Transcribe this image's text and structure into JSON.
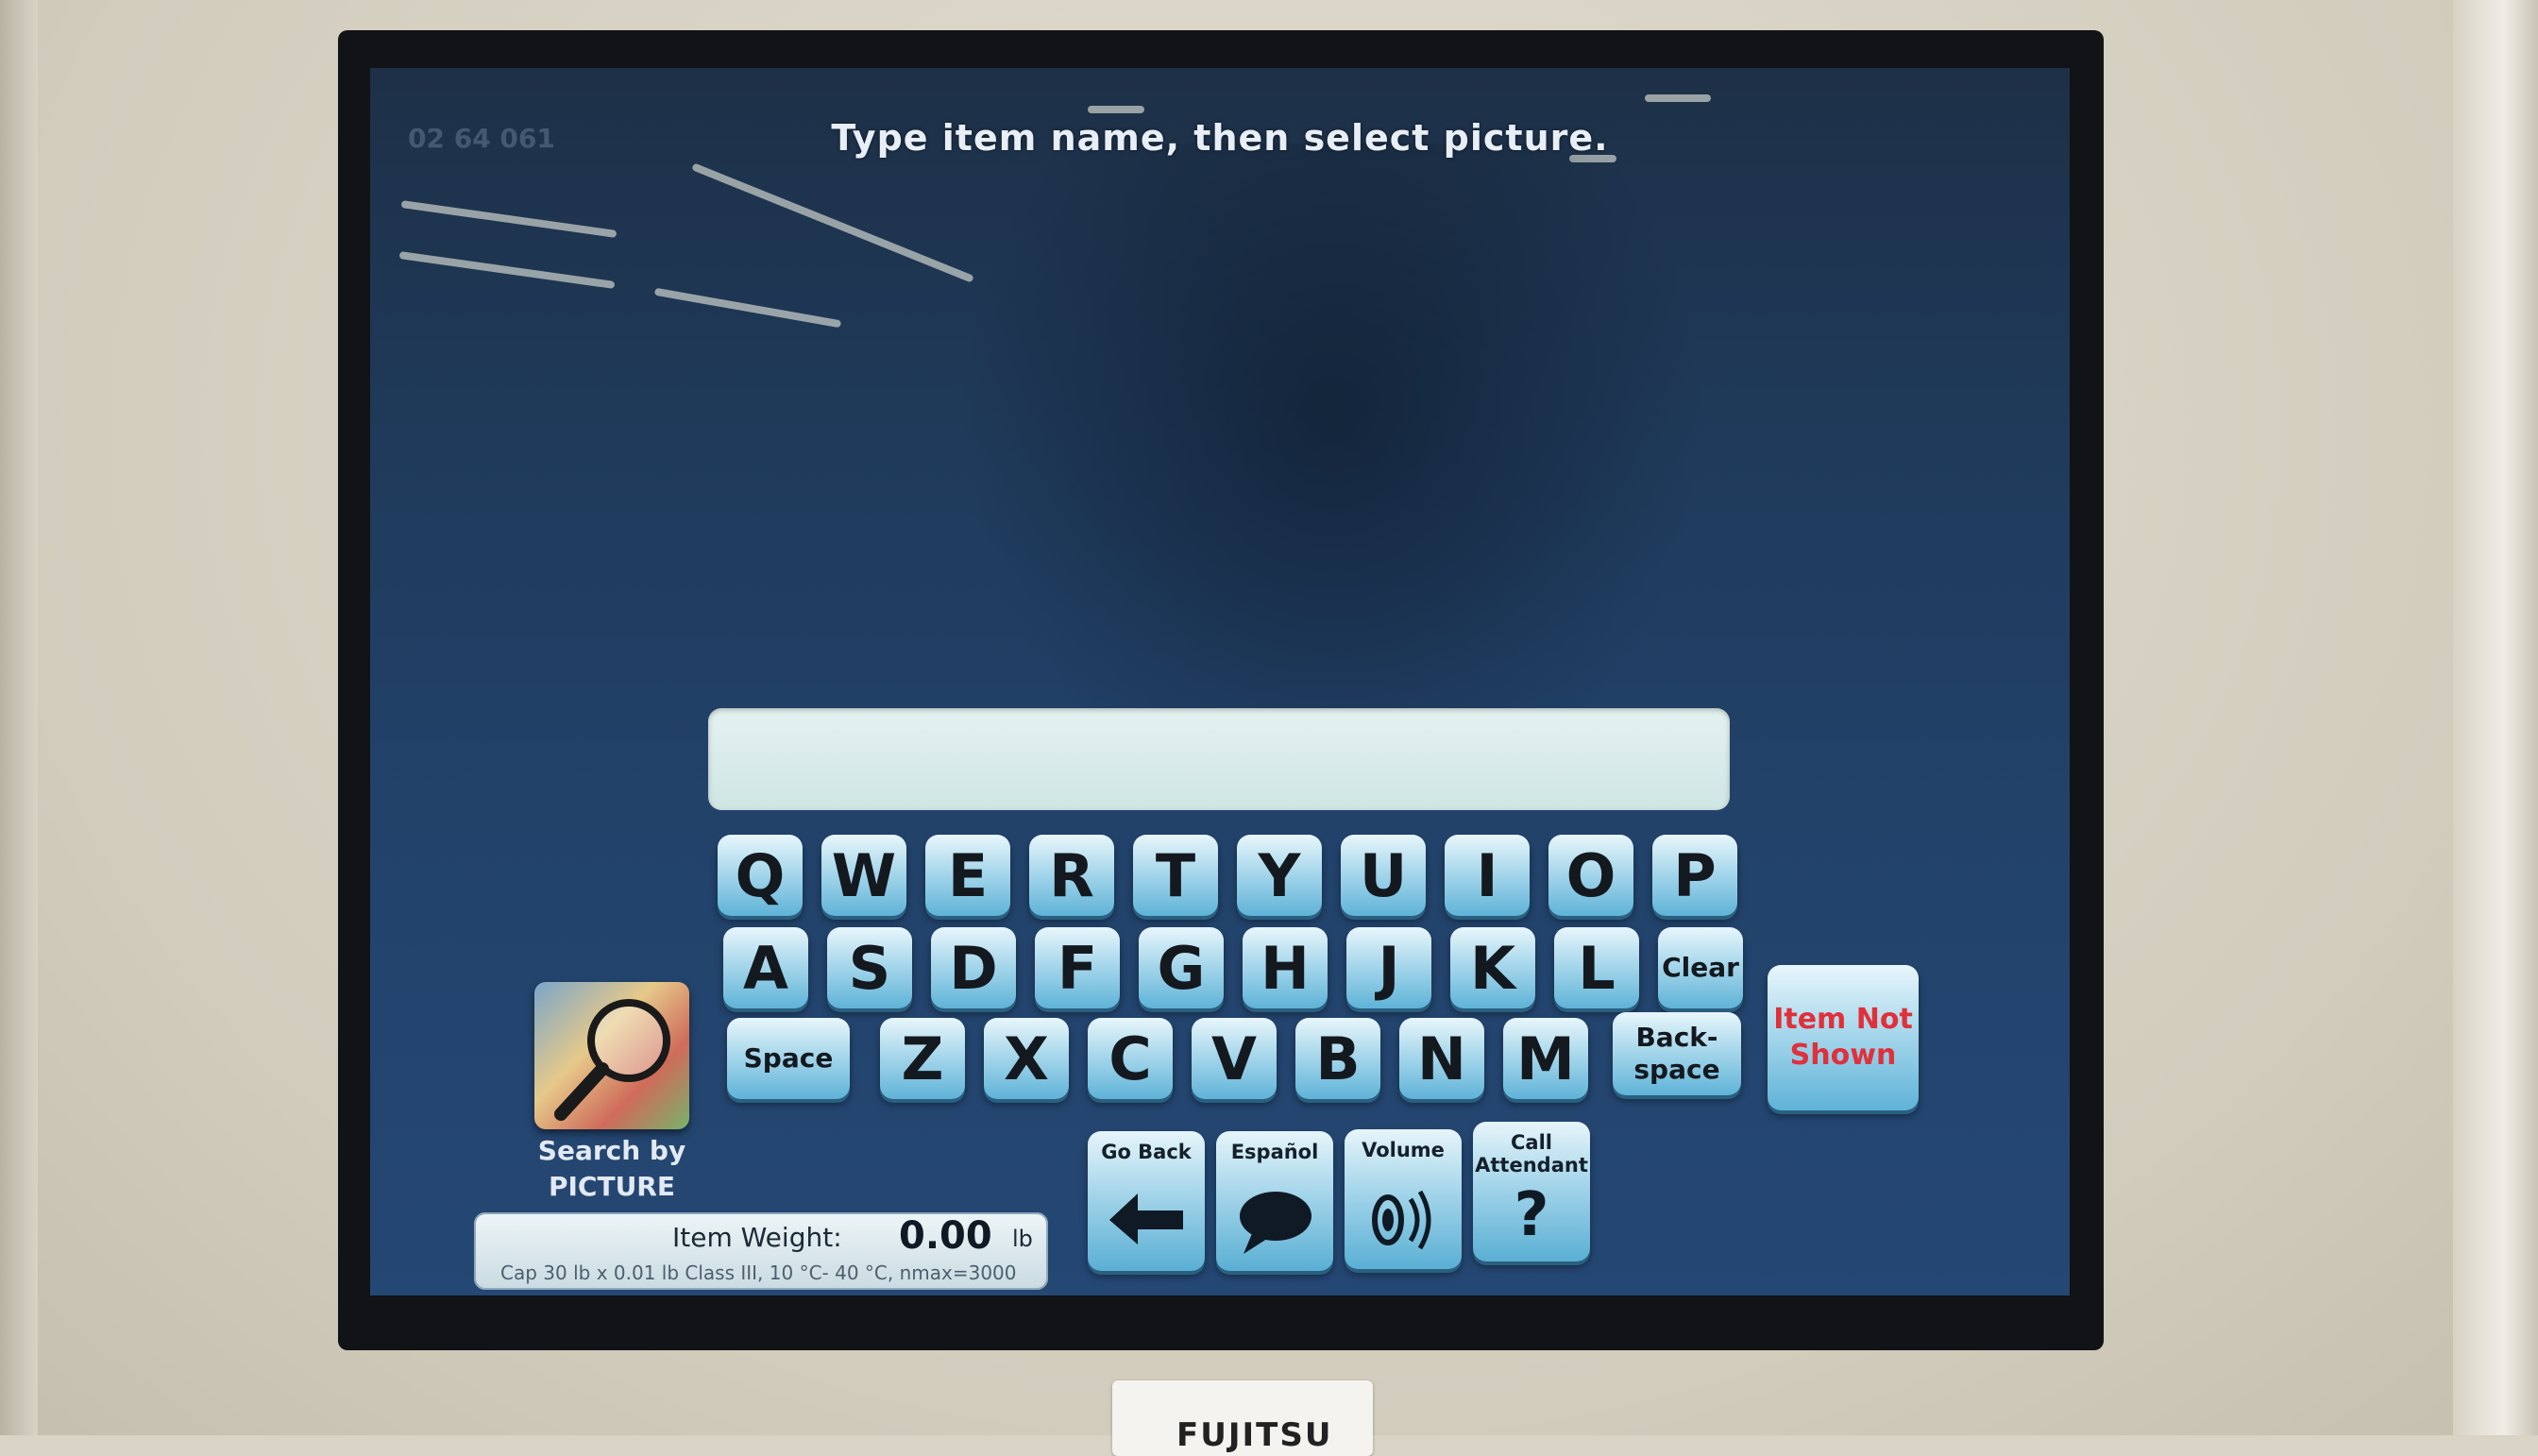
{
  "screen": {
    "store_id": "02 64 061",
    "prompt": "Type item name, then select picture.",
    "search_value": ""
  },
  "keyboard": {
    "row1": [
      "Q",
      "W",
      "E",
      "R",
      "T",
      "Y",
      "U",
      "I",
      "O",
      "P"
    ],
    "row2": [
      "A",
      "S",
      "D",
      "F",
      "G",
      "H",
      "J",
      "K",
      "L"
    ],
    "row3": [
      "Z",
      "X",
      "C",
      "V",
      "B",
      "N",
      "M"
    ],
    "clear_label": "Clear",
    "space_label": "Space",
    "backspace_label": "Back-\nspace",
    "item_not_shown_label": "Item Not\nShown"
  },
  "search_by_picture": {
    "line1": "Search by",
    "line2": "PICTURE"
  },
  "weight": {
    "label": "Item Weight:",
    "value": "0.00",
    "unit": "lb",
    "cap_text": "Cap 30 lb x 0.01 lb Class III, 10 °C- 40 °C, nmax=3000"
  },
  "function_keys": {
    "go_back": "Go Back",
    "espanol": "Español",
    "volume": "Volume",
    "call_attendant": "Call\nAttendant"
  },
  "hardware": {
    "brand_label": "FUJITSU"
  },
  "colors": {
    "screen_bg": "#22426a",
    "key_top": "#e8f6fb",
    "key_bottom": "#5fb3d8",
    "item_not_shown_text": "#e0303a"
  }
}
